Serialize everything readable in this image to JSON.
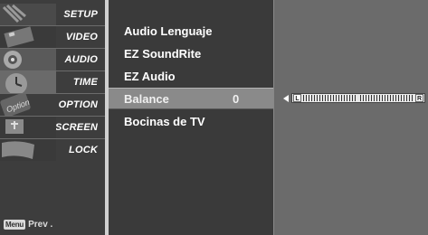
{
  "sidebar": {
    "items": [
      {
        "label": "SETUP",
        "icon": "setup-icon"
      },
      {
        "label": "VIDEO",
        "icon": "video-icon"
      },
      {
        "label": "AUDIO",
        "icon": "audio-icon"
      },
      {
        "label": "TIME",
        "icon": "time-icon"
      },
      {
        "label": "OPTION",
        "icon": "option-icon"
      },
      {
        "label": "SCREEN",
        "icon": "screen-icon"
      },
      {
        "label": "LOCK",
        "icon": "lock-icon"
      }
    ],
    "option_icon_text": "Option",
    "menu_badge": "Menu",
    "prev_label": "Prev ."
  },
  "submenu": {
    "items": [
      {
        "label": "Audio Lenguaje"
      },
      {
        "label": "EZ SoundRite"
      },
      {
        "label": "EZ Audio"
      },
      {
        "label": "Balance",
        "value": "0",
        "selected": true
      },
      {
        "label": "Bocinas de TV"
      }
    ]
  },
  "balance": {
    "left_tag": "L",
    "right_tag": "R",
    "value": 0,
    "range": [
      -50,
      50
    ]
  },
  "colors": {
    "background": "#6b6b6b",
    "sidebar": "#3d3d3d",
    "submenu": "#3a3a3a",
    "selected_row": "#8a8a8a"
  }
}
